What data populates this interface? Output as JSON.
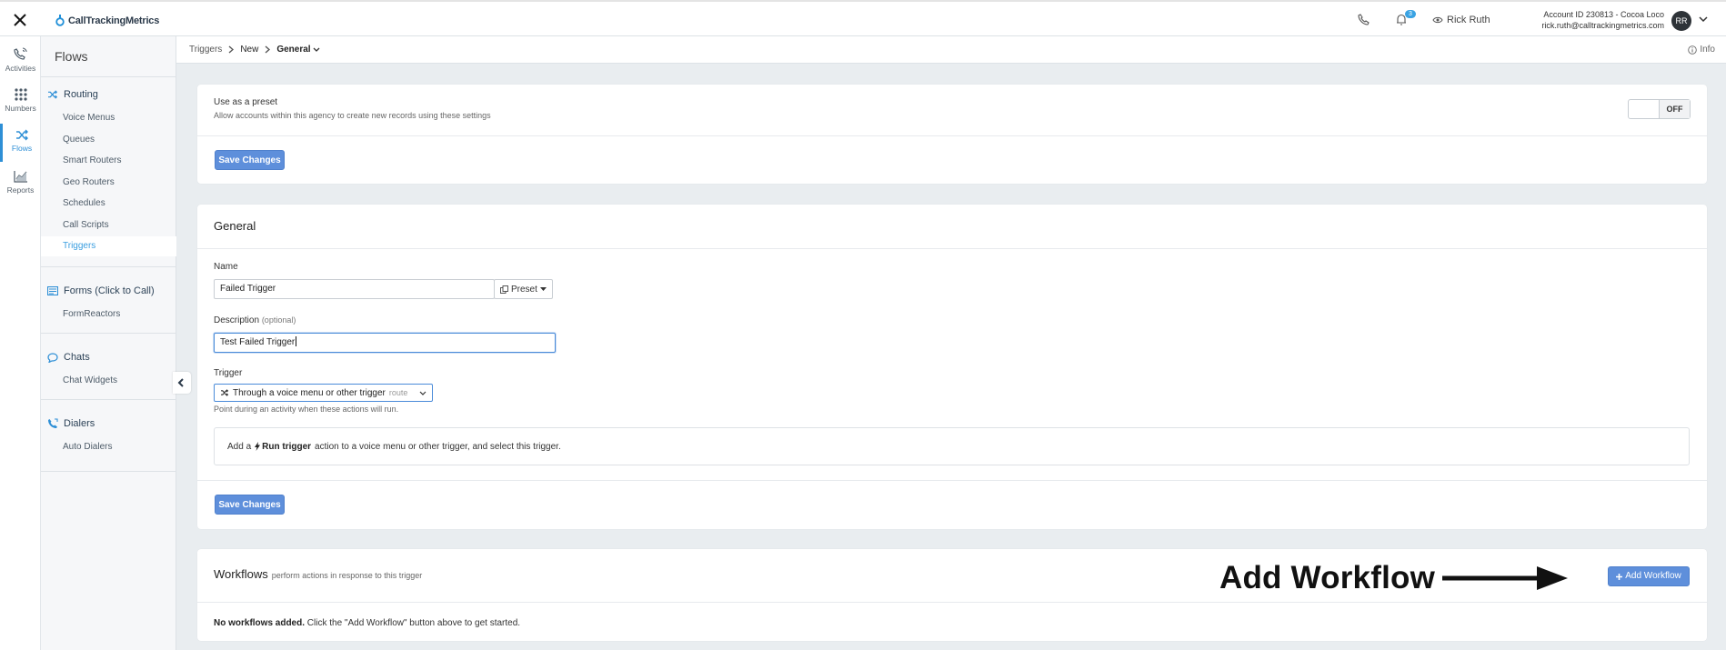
{
  "topbar": {
    "logo_text": "CallTrackingMetrics",
    "notification_count": "3",
    "user_name": "Rick Ruth",
    "account_line": "Account ID 230813  -  Cocoa Loco",
    "email": "rick.ruth@calltrackingmetrics.com",
    "avatar_initials": "RR"
  },
  "rail": [
    {
      "label": "Activities",
      "icon": "phone-activity-icon"
    },
    {
      "label": "Numbers",
      "icon": "grid-icon"
    },
    {
      "label": "Flows",
      "icon": "shuffle-icon",
      "active": true
    },
    {
      "label": "Reports",
      "icon": "chart-icon"
    }
  ],
  "sidebar": {
    "title": "Flows",
    "sections": [
      {
        "label": "Routing",
        "icon": "shuffle-icon",
        "items": [
          "Voice Menus",
          "Queues",
          "Smart Routers",
          "Geo Routers",
          "Schedules",
          "Call Scripts",
          "Triggers"
        ]
      },
      {
        "label": "Forms (Click to Call)",
        "icon": "form-icon",
        "items": [
          "FormReactors"
        ]
      },
      {
        "label": "Chats",
        "icon": "chat-icon",
        "items": [
          "Chat Widgets"
        ]
      },
      {
        "label": "Dialers",
        "icon": "dialer-icon",
        "items": [
          "Auto Dialers"
        ]
      }
    ],
    "active_item": "Triggers"
  },
  "breadcrumb": {
    "items": [
      "Triggers",
      "New",
      "General"
    ],
    "info": "Info"
  },
  "preset_card": {
    "title": "Use as a preset",
    "subtitle": "Allow accounts within this agency to create new records using these settings",
    "toggle_state": "OFF",
    "save_label": "Save Changes"
  },
  "general_card": {
    "heading": "General",
    "name_label": "Name",
    "name_value": "Failed Trigger",
    "preset_label": "Preset",
    "description_label": "Description",
    "description_optional": "(optional)",
    "description_value": "Test Failed Trigger",
    "trigger_label": "Trigger",
    "trigger_value": "Through a voice menu or other trigger",
    "trigger_tag": "route",
    "trigger_hint": "Point during an activity when these actions will run.",
    "note_prefix": "Add a",
    "note_bold": "Run trigger",
    "note_suffix": "action to a voice menu or other trigger, and select this trigger.",
    "save_label": "Save Changes"
  },
  "workflows_card": {
    "title": "Workflows",
    "subtitle": "perform actions in response to this trigger",
    "annotation": "Add Workflow",
    "add_button": "Add Workflow",
    "empty_bold": "No workflows added.",
    "empty_text": "Click the \"Add Workflow\" button above to get started."
  },
  "colors": {
    "primary": "#5e8fdb",
    "accent": "#2e8fd6",
    "background": "#e9edf0"
  }
}
